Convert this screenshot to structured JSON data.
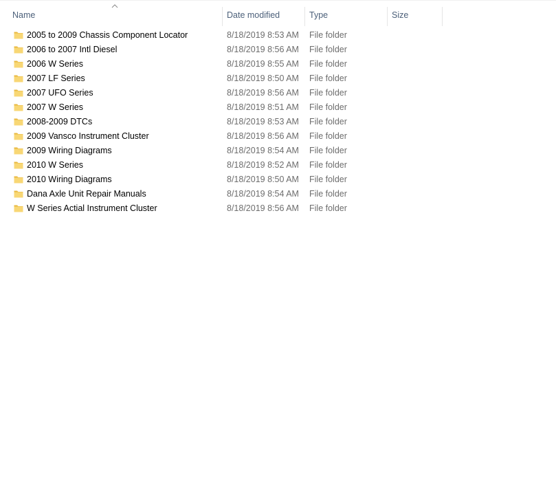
{
  "columns": {
    "name": "Name",
    "date_modified": "Date modified",
    "type": "Type",
    "size": "Size"
  },
  "sort": {
    "column": "name",
    "direction": "ascending"
  },
  "icons": {
    "folder": "folder-icon",
    "sort": "sort-ascending-icon"
  },
  "colors": {
    "header_text": "#4c607a",
    "meta_text": "#6d6d6d",
    "folder_fill": "#f8d775",
    "folder_tab": "#e8b840"
  },
  "files": [
    {
      "name": "2005 to 2009 Chassis Component Locator",
      "date": "8/18/2019 8:53 AM",
      "type": "File folder",
      "size": ""
    },
    {
      "name": "2006 to 2007 Intl Diesel",
      "date": "8/18/2019 8:56 AM",
      "type": "File folder",
      "size": ""
    },
    {
      "name": "2006 W Series",
      "date": "8/18/2019 8:55 AM",
      "type": "File folder",
      "size": ""
    },
    {
      "name": "2007 LF Series",
      "date": "8/18/2019 8:50 AM",
      "type": "File folder",
      "size": ""
    },
    {
      "name": "2007 UFO Series",
      "date": "8/18/2019 8:56 AM",
      "type": "File folder",
      "size": ""
    },
    {
      "name": "2007 W Series",
      "date": "8/18/2019 8:51 AM",
      "type": "File folder",
      "size": ""
    },
    {
      "name": "2008-2009 DTCs",
      "date": "8/18/2019 8:53 AM",
      "type": "File folder",
      "size": ""
    },
    {
      "name": "2009 Vansco Instrument Cluster",
      "date": "8/18/2019 8:56 AM",
      "type": "File folder",
      "size": ""
    },
    {
      "name": "2009 Wiring Diagrams",
      "date": "8/18/2019 8:54 AM",
      "type": "File folder",
      "size": ""
    },
    {
      "name": "2010 W Series",
      "date": "8/18/2019 8:52 AM",
      "type": "File folder",
      "size": ""
    },
    {
      "name": "2010 Wiring Diagrams",
      "date": "8/18/2019 8:50 AM",
      "type": "File folder",
      "size": ""
    },
    {
      "name": "Dana Axle Unit Repair Manuals",
      "date": "8/18/2019 8:54 AM",
      "type": "File folder",
      "size": ""
    },
    {
      "name": "W Series Actial Instrument Cluster",
      "date": "8/18/2019 8:56 AM",
      "type": "File folder",
      "size": ""
    }
  ]
}
